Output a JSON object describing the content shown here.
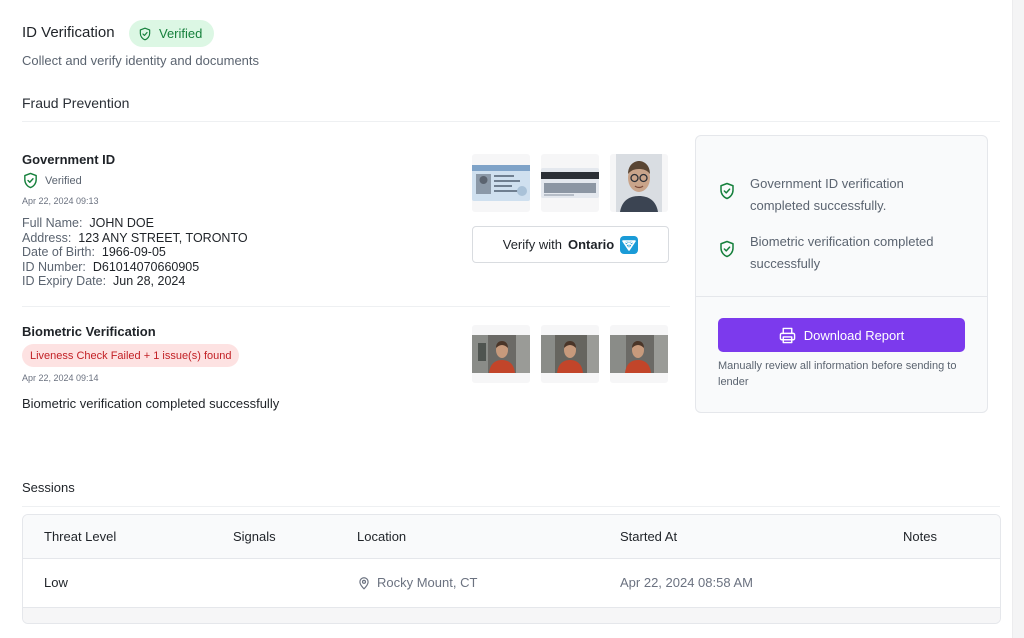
{
  "header": {
    "title": "ID Verification",
    "badge": "Verified",
    "subtitle": "Collect and verify identity and documents"
  },
  "section": {
    "title": "Fraud Prevention"
  },
  "government_id": {
    "title": "Government ID",
    "status": "Verified",
    "timestamp": "Apr 22, 2024 09:13",
    "fields": [
      {
        "label": "Full Name:",
        "value": "JOHN DOE"
      },
      {
        "label": "Address:",
        "value": "123 ANY STREET, TORONTO"
      },
      {
        "label": "Date of Birth:",
        "value": "1966-09-05"
      },
      {
        "label": "ID Number:",
        "value": "D61014070660905"
      },
      {
        "label": "ID Expiry Date:",
        "value": "Jun 28, 2024"
      }
    ],
    "verify_button": {
      "prefix": "Verify with",
      "brand": "Ontario"
    }
  },
  "biometric": {
    "title": "Biometric Verification",
    "badge": "Liveness Check Failed + 1 issue(s) found",
    "timestamp": "Apr 22, 2024 09:14",
    "result": "Biometric verification completed successfully"
  },
  "panel": {
    "items": [
      "Government ID verification completed successfully.",
      "Biometric verification completed successfully"
    ],
    "download_label": "Download Report",
    "note": "Manually review all information before sending to lender"
  },
  "sessions": {
    "title": "Sessions",
    "columns": [
      "Threat Level",
      "Signals",
      "Location",
      "Started At",
      "Notes"
    ],
    "rows": [
      {
        "threat_level": "Low",
        "signals": "",
        "location": "Rocky Mount, CT",
        "started_at": "Apr 22, 2024 08:58 AM",
        "notes": ""
      }
    ]
  },
  "colors": {
    "accent": "#7c3aed",
    "success": "#16803c",
    "success_bg": "#dcf7e4",
    "danger": "#c21f24",
    "danger_bg": "#fde2e2"
  }
}
